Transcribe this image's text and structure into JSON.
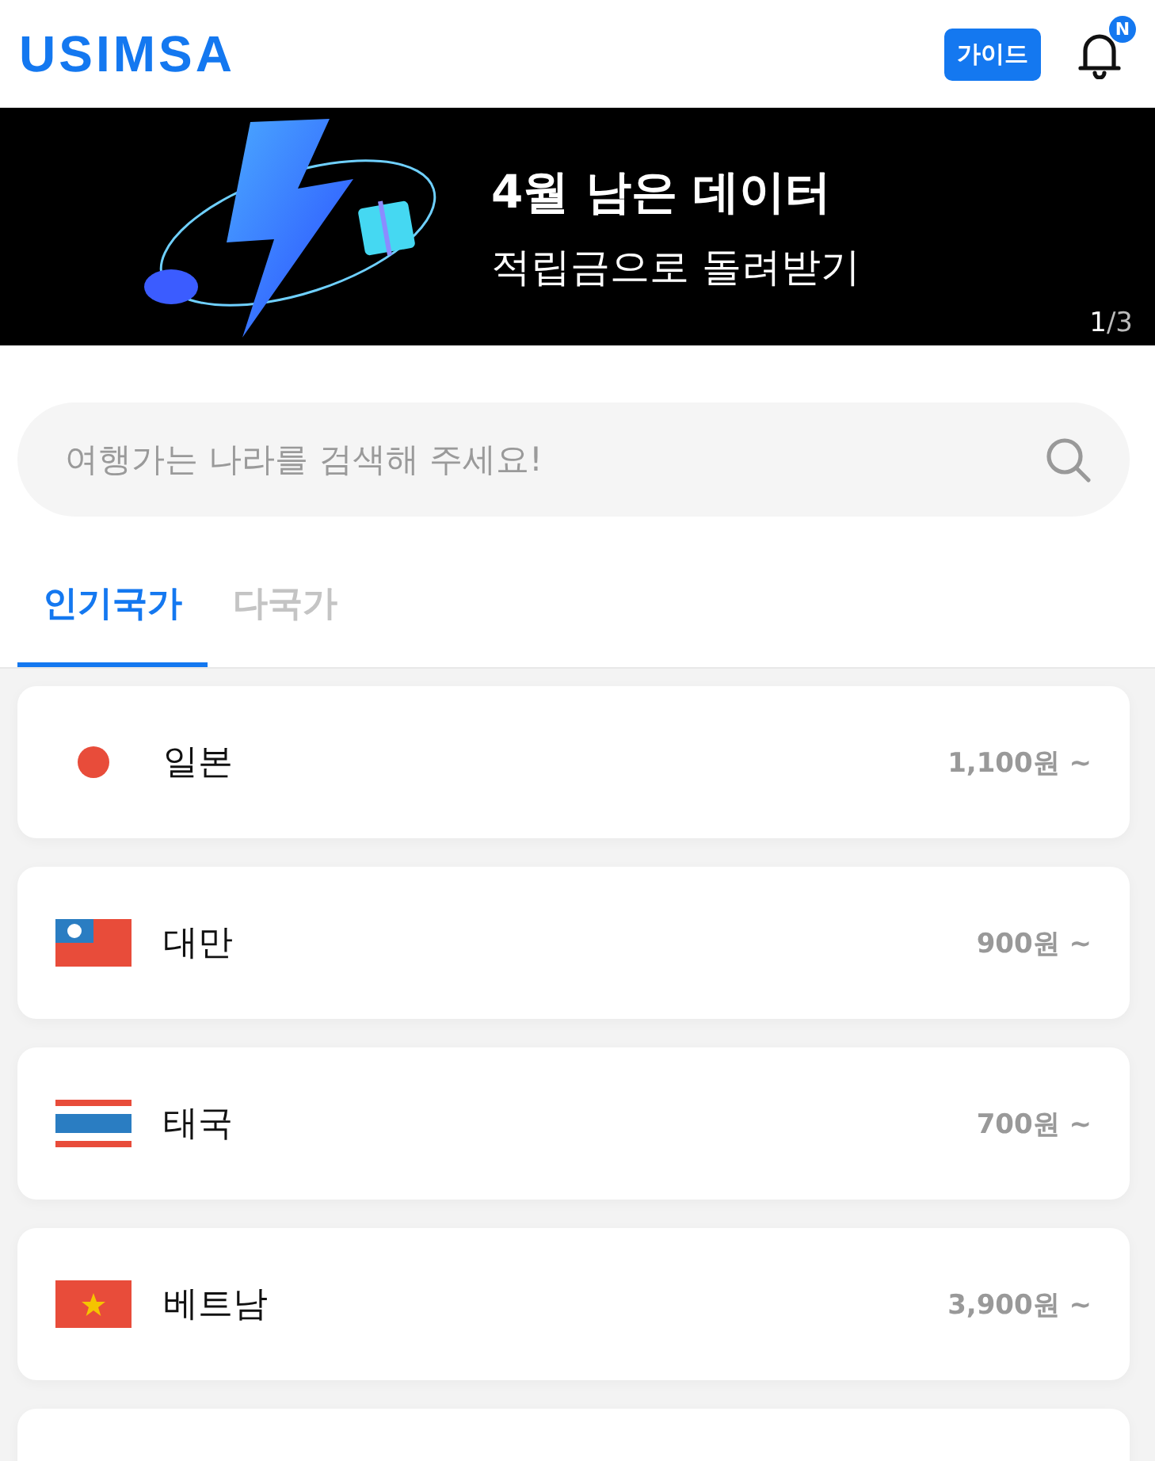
{
  "header": {
    "logo": "USIMSA",
    "guide_button": "가이드",
    "notification_badge": "N"
  },
  "banner": {
    "title": "4월 남은 데이터",
    "subtitle": "적립금으로 돌려받기",
    "page_current": "1",
    "page_total": "/3"
  },
  "search": {
    "placeholder": "여행가는 나라를 검색해 주세요!"
  },
  "tabs": [
    {
      "label": "인기국가",
      "selected": true
    },
    {
      "label": "다국가",
      "selected": false
    }
  ],
  "countries": [
    {
      "name": "일본",
      "price": "1,100원 ~",
      "kind": "japan"
    },
    {
      "name": "대만",
      "price": "900원 ~",
      "kind": "taiwan"
    },
    {
      "name": "태국",
      "price": "700원 ~",
      "kind": "thailand"
    },
    {
      "name": "베트남",
      "price": "3,900원 ~",
      "kind": "vietnam"
    }
  ]
}
